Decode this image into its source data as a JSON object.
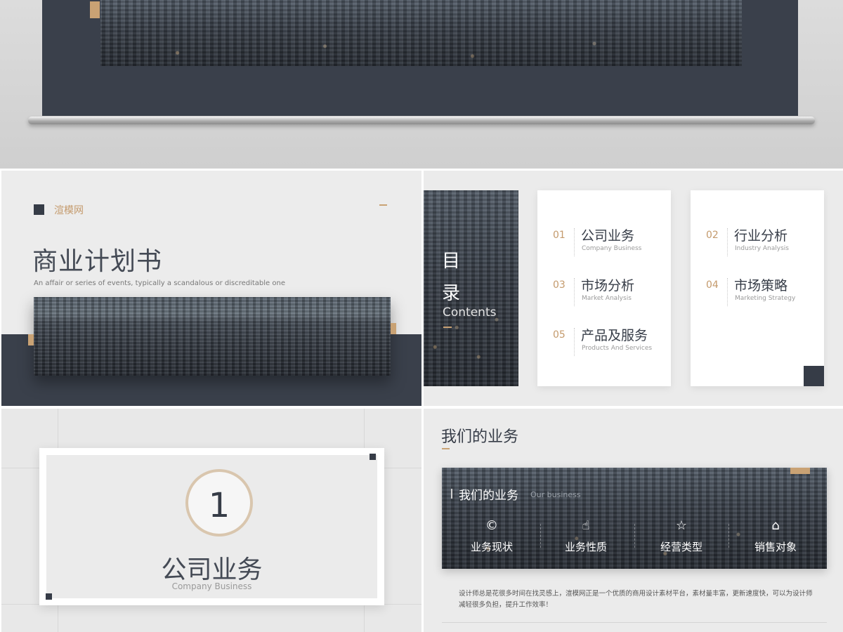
{
  "colors": {
    "navy": "#3a404b",
    "gold": "#c9a274",
    "background": "#ececec",
    "text_dark": "#363c47"
  },
  "cover": {
    "brand": "渲模网",
    "title": "商业计划书",
    "subtitle": "An affair or series of events, typically a scandalous or discreditable one"
  },
  "contents": {
    "title_cn_1": "目",
    "title_cn_2": "录",
    "title_en": "Contents",
    "items": [
      {
        "num": "01",
        "cn": "公司业务",
        "en": "Company Business"
      },
      {
        "num": "02",
        "cn": "行业分析",
        "en": "Industry Analysis"
      },
      {
        "num": "03",
        "cn": "市场分析",
        "en": "Market Analysis"
      },
      {
        "num": "04",
        "cn": "市场策略",
        "en": "Marketing Strategy"
      },
      {
        "num": "05",
        "cn": "产品及服务",
        "en": "Products And Services"
      }
    ]
  },
  "section": {
    "number": "1",
    "cn": "公司业务",
    "en": "Company Business"
  },
  "business": {
    "heading": "我们的业务",
    "band_cn": "我们的业务",
    "band_en": "Our business",
    "features": [
      {
        "icon": "copyright-badge-icon",
        "glyph": "©",
        "label": "业务现状"
      },
      {
        "icon": "thumbs-up-icon",
        "glyph": "☝",
        "label": "业务性质"
      },
      {
        "icon": "star-icon",
        "glyph": "☆",
        "label": "经营类型"
      },
      {
        "icon": "tag-icon",
        "glyph": "⌂",
        "label": "销售对象"
      }
    ],
    "description": "设计师总是花很多时间在找灵感上，渲模网正是一个优质的商用设计素材平台，素材量丰富，更新速度快，可以为设计师减轻很多负担，提升工作效率！"
  }
}
